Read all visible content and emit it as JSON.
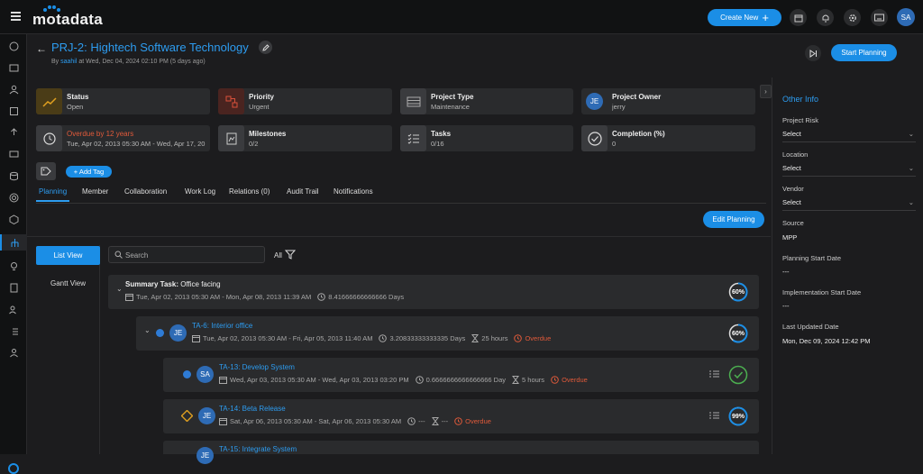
{
  "app": {
    "logo": "motadata"
  },
  "topbar": {
    "create_label": "Create New",
    "avatar": "SA"
  },
  "header": {
    "title": "PRJ-2: Hightech Software Technology",
    "by": "By",
    "user": "saahil",
    "when": "at Wed, Dec 04, 2024 02:10 PM (5 days ago)",
    "start_label": "Start Planning"
  },
  "cards": [
    {
      "label": "Status",
      "value": "Open",
      "icon": "trend-icon",
      "color": "#e0a020"
    },
    {
      "label": "Priority",
      "value": "Urgent",
      "icon": "priority-icon",
      "color": "#d9503a"
    },
    {
      "label": "Project Type",
      "value": "Maintenance",
      "icon": "project-type-icon"
    },
    {
      "label": "Project Owner",
      "value": "jerry",
      "initials": "JE"
    },
    {
      "label": "Overdue by 12 years",
      "value": "Tue, Apr 02, 2013 05:30 AM - Wed, Apr 17, 20",
      "icon": "clock-icon",
      "color": "#e05a3a"
    },
    {
      "label": "Milestones",
      "value": "0/2",
      "icon": "milestone-icon"
    },
    {
      "label": "Tasks",
      "value": "0/16",
      "icon": "tasks-icon"
    },
    {
      "label": "Completion (%)",
      "value": "0",
      "icon": "check-circle-icon"
    }
  ],
  "tags": {
    "add_label": "+ Add Tag"
  },
  "tabs": [
    "Planning",
    "Member",
    "Collaboration",
    "Work Log",
    "Relations (0)",
    "Audit Trail",
    "Notifications"
  ],
  "planning": {
    "edit_label": "Edit Planning",
    "list_view": "List View",
    "gantt_view": "Gantt View",
    "search_placeholder": "Search",
    "filter_label": "All"
  },
  "rows": [
    {
      "prefix": "Summary Task:",
      "name": "Office facing",
      "dates": "Tue, Apr 02, 2013 05:30 AM - Mon, Apr 08, 2013 11:39 AM",
      "duration": "8.41666666666666 Days",
      "progress": 60,
      "progress_label": "60%"
    },
    {
      "name": "TA-6: Interior office",
      "initials": "JE",
      "dates": "Tue, Apr 02, 2013 05:30 AM - Fri, Apr 05, 2013 11:40 AM",
      "duration": "3.20833333333335 Days",
      "effort": "25 hours",
      "status": "Overdue",
      "progress": 60,
      "progress_label": "60%"
    },
    {
      "name": "TA-13: Develop System",
      "initials": "SA",
      "dates": "Wed, Apr 03, 2013 05:30 AM - Wed, Apr 03, 2013 03:20 PM",
      "duration": "0.6666666666666666 Day",
      "effort": "5 hours",
      "status": "Overdue",
      "progress": 100,
      "progress_label": ""
    },
    {
      "name": "TA-14: Beta Release",
      "initials": "JE",
      "dates": "Sat, Apr 06, 2013 05:30 AM - Sat, Apr 06, 2013 05:30 AM",
      "duration": "---",
      "effort": "---",
      "status": "Overdue",
      "progress": 99,
      "progress_label": "99%"
    },
    {
      "name": "TA-15: Integrate System",
      "initials": "JE"
    }
  ],
  "other_info": {
    "title": "Other Info",
    "project_risk_label": "Project Risk",
    "project_risk": "Select",
    "location_label": "Location",
    "location": "Select",
    "vendor_label": "Vendor",
    "vendor": "Select",
    "source_label": "Source",
    "source": "MPP",
    "planning_start_label": "Planning Start Date",
    "planning_start": "---",
    "impl_start_label": "Implementation Start Date",
    "impl_start": "---",
    "last_updated_label": "Last Updated Date",
    "last_updated": "Mon, Dec 09, 2024 12:42 PM"
  },
  "colors": {
    "accent": "#1b8ee6",
    "overdue": "#e05a3a",
    "success": "#4caf50"
  }
}
